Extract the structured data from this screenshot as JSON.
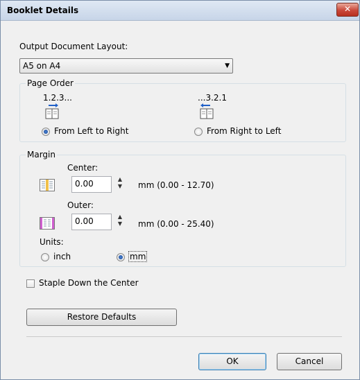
{
  "window": {
    "title": "Booklet Details",
    "close_glyph": "✕"
  },
  "layout": {
    "label": "Output Document Layout:",
    "selected": "A5 on A4",
    "arrow": "▼"
  },
  "page_order": {
    "legend": "Page Order",
    "ltr_sequence": "1.2.3...",
    "rtl_sequence": "...3.2.1",
    "ltr_label": "From Left to Right",
    "rtl_label": "From Right to Left",
    "selected": "ltr"
  },
  "margin": {
    "legend": "Margin",
    "center_label": "Center:",
    "center_value": "0.00",
    "center_range": "mm (0.00 - 12.70)",
    "outer_label": "Outer:",
    "outer_value": "0.00",
    "outer_range": "mm (0.00 - 25.40)",
    "units_label": "Units:",
    "inch_label": "inch",
    "mm_label": "mm",
    "selected_unit": "mm",
    "spin_up": "▲",
    "spin_down": "▼"
  },
  "staple": {
    "label": "Staple Down the Center",
    "checked": false
  },
  "buttons": {
    "restore": "Restore Defaults",
    "ok": "OK",
    "cancel": "Cancel"
  },
  "colors": {
    "center_icon": "#f0c04a",
    "outer_icon": "#d060d0",
    "book_arrow": "#2060c8",
    "accent": "#3c7fb1"
  }
}
